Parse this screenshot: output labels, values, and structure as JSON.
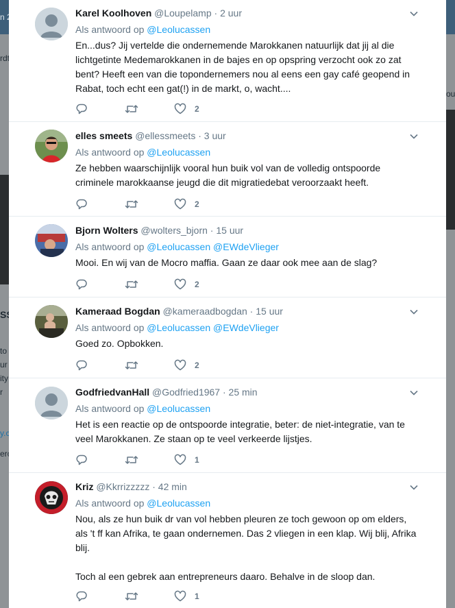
{
  "tweets": [
    {
      "name": "Karel Koolhoven",
      "handle": "@Loupelamp",
      "sep": "·",
      "time": "2 uur",
      "reply_prefix": "Als antwoord op",
      "mentions": [
        "@Leolucassen"
      ],
      "text": "En...dus? Jij vertelde die ondernemende Marokkanen natuurlijk dat jij al die\nlichtgetinte Medemarokkanen in de bajes en op opspring verzocht ook zo zat\nbent? Heeft een van die topondernemers nou al eens een gay café geopend in\nRabat, toch echt een gat(!) in de markt, o, wacht....",
      "likes": "2",
      "avatar": "default-avatar"
    },
    {
      "name": "elles smeets",
      "handle": "@ellessmeets",
      "sep": "·",
      "time": "3 uur",
      "reply_prefix": "Als antwoord op",
      "mentions": [
        "@Leolucassen"
      ],
      "text": "Ze hebben waarschijnlijk vooral hun buik vol van de volledig ontspoorde\ncriminele marokkaanse jeugd die dit migratiedebat veroorzaakt heeft.",
      "likes": "2",
      "avatar": "photo-avatar"
    },
    {
      "name": "Bjorn Wolters",
      "handle": "@wolters_bjorn",
      "sep": "·",
      "time": "15 uur",
      "reply_prefix": "Als antwoord op",
      "mentions": [
        "@Leolucassen",
        "@EWdeVlieger"
      ],
      "text": "Mooi. En wij van de Mocro maffia. Gaan ze daar ook mee aan de slag?",
      "likes": "2",
      "avatar": "photo-avatar"
    },
    {
      "name": "Kameraad Bogdan",
      "handle": "@kameraadbogdan",
      "sep": "·",
      "time": "15 uur",
      "reply_prefix": "Als antwoord op",
      "mentions": [
        "@Leolucassen",
        "@EWdeVlieger"
      ],
      "text": "Goed zo. Opbokken.",
      "likes": "2",
      "avatar": "photo-avatar"
    },
    {
      "name": "GodfriedvanHall",
      "handle": "@Godfried1967",
      "sep": "·",
      "time": "25 min",
      "reply_prefix": "Als antwoord op",
      "mentions": [
        "@Leolucassen"
      ],
      "text": "Het is een reactie op de ontspoorde integratie, beter: de niet-integratie, van te\nveel Marokkanen. Ze staan op te veel verkeerde lijstjes.",
      "likes": "1",
      "avatar": "default-avatar"
    },
    {
      "name": "Kriz",
      "handle": "@Kkrrizzzzz",
      "sep": "·",
      "time": "42 min",
      "reply_prefix": "Als antwoord op",
      "mentions": [
        "@Leolucassen"
      ],
      "text": "Nou, als ze hun buik dr van vol hebben pleuren ze toch gewoon op om elders,\nals 't ff kan Afrika, te gaan ondernemen. Das 2 vliegen in een klap. Wij blij, Afrika\nblij.\n\nToch al een gebrek aan entrepreneurs daaro. Behalve in de sloop dan.",
      "likes": "1",
      "avatar": "logo-avatar"
    }
  ],
  "background": {
    "fragments": [
      "n 2",
      "rdt",
      "SS",
      "to",
      "ur",
      "ity",
      "r",
      "y.c",
      "erc",
      "ou"
    ]
  },
  "colors": {
    "link": "#1da1f2",
    "muted": "#657786",
    "text": "#14171a",
    "divider": "#e6ecf0",
    "overlay": "#6b6e70"
  },
  "icons": {
    "reply": "reply-icon",
    "retweet": "retweet-icon",
    "like": "heart-icon",
    "caret": "chevron-down-icon"
  }
}
